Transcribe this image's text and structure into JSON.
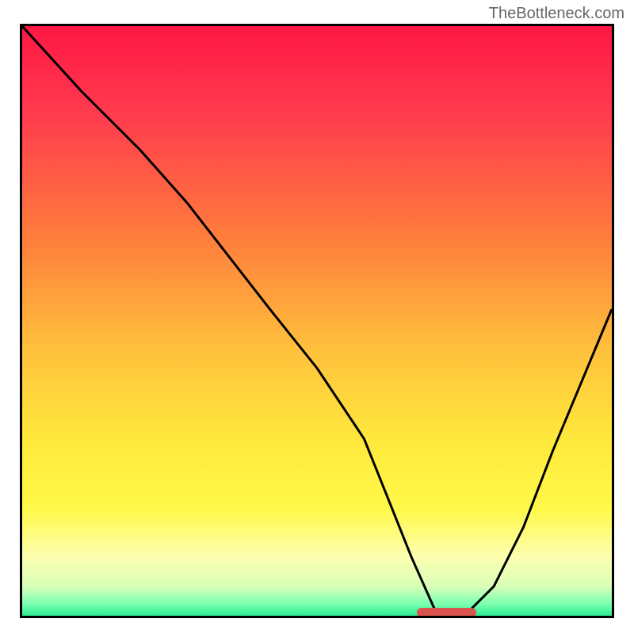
{
  "watermark": "TheBottleneck.com",
  "chart_data": {
    "type": "line",
    "title": "",
    "xlabel": "",
    "ylabel": "",
    "xlim": [
      0,
      100
    ],
    "ylim": [
      0,
      100
    ],
    "gradient_stops": [
      {
        "offset": 0,
        "color": "#ff1744"
      },
      {
        "offset": 15,
        "color": "#ff3b4e"
      },
      {
        "offset": 35,
        "color": "#ff7a3c"
      },
      {
        "offset": 55,
        "color": "#ffc13c"
      },
      {
        "offset": 70,
        "color": "#ffe83c"
      },
      {
        "offset": 82,
        "color": "#fff94a"
      },
      {
        "offset": 90,
        "color": "#fdffb0"
      },
      {
        "offset": 95,
        "color": "#d9ffb8"
      },
      {
        "offset": 98,
        "color": "#7affb0"
      },
      {
        "offset": 100,
        "color": "#2cea8f"
      }
    ],
    "series": [
      {
        "name": "curve",
        "x": [
          0,
          10,
          20,
          28,
          35,
          42,
          50,
          58,
          62,
          66,
          70,
          75,
          80,
          85,
          90,
          95,
          100
        ],
        "y": [
          100,
          89,
          79,
          70,
          61,
          52,
          42,
          30,
          20,
          10,
          1,
          0,
          5,
          15,
          28,
          40,
          52
        ]
      }
    ],
    "marker": {
      "x_start": 67,
      "x_end": 77,
      "y": 0.5
    }
  }
}
